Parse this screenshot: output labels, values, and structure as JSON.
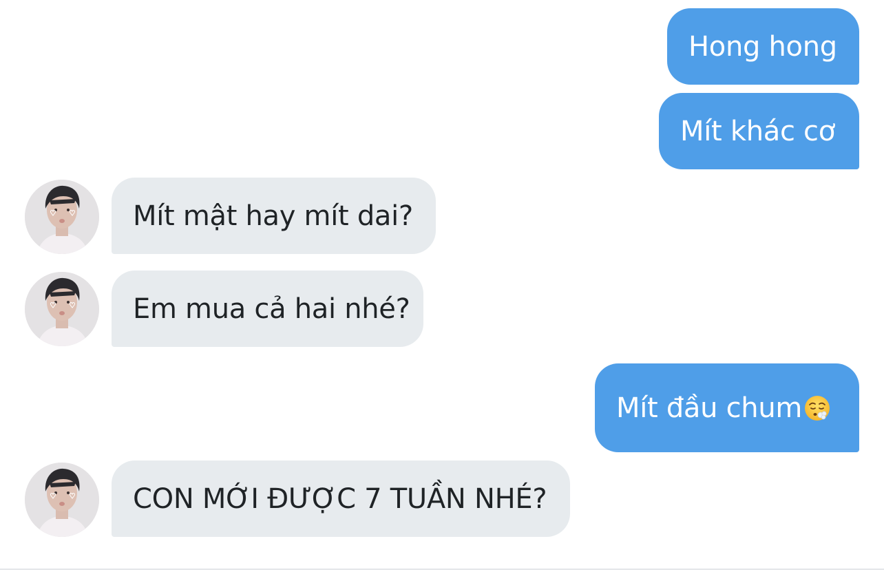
{
  "conversation": {
    "messages": [
      {
        "sender": "me",
        "text": "Hong hong"
      },
      {
        "sender": "me",
        "text": "Mít khác cơ"
      },
      {
        "sender": "contact",
        "text": "Mít mật hay mít dai?"
      },
      {
        "sender": "contact",
        "text": "Em mua cả hai nhé?"
      },
      {
        "sender": "me",
        "text": "Mít đầu chum",
        "emoji": "face-exhaling-icon"
      },
      {
        "sender": "contact",
        "text": "CON MỚI ĐƯỢC 7 TUẦN NHÉ?"
      }
    ]
  },
  "colors": {
    "outgoing_bubble": "#4f9ee8",
    "incoming_bubble": "#e7ebee",
    "outgoing_text": "#ffffff",
    "incoming_text": "#1f2326"
  }
}
